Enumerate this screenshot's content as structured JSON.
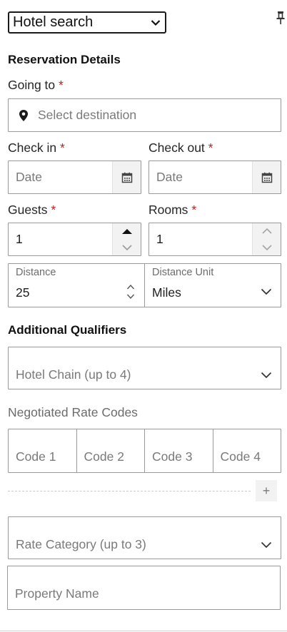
{
  "search_type": {
    "selected": "Hotel search"
  },
  "reservation": {
    "title": "Reservation Details",
    "going_to": {
      "label": "Going to",
      "required": "*",
      "placeholder": "Select destination"
    },
    "check_in": {
      "label": "Check in",
      "required": "*",
      "placeholder": "Date"
    },
    "check_out": {
      "label": "Check out",
      "required": "*",
      "placeholder": "Date"
    },
    "guests": {
      "label": "Guests",
      "required": "*",
      "value": "1"
    },
    "rooms": {
      "label": "Rooms",
      "required": "*",
      "value": "1"
    },
    "distance": {
      "label": "Distance",
      "value": "25"
    },
    "distance_unit": {
      "label": "Distance Unit",
      "value": "Miles"
    }
  },
  "qualifiers": {
    "title": "Additional Qualifiers",
    "hotel_chain": {
      "placeholder": "Hotel Chain (up to 4)"
    },
    "rate_codes": {
      "label": "Negotiated Rate Codes",
      "codes": [
        "Code 1",
        "Code 2",
        "Code 3",
        "Code 4"
      ],
      "add": "+"
    },
    "rate_category": {
      "placeholder": "Rate Category (up to 3)"
    },
    "property_name": {
      "placeholder": "Property Name"
    }
  }
}
